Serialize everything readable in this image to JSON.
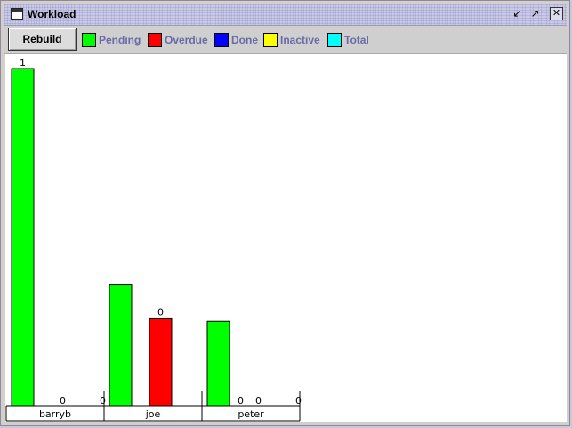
{
  "window": {
    "title": "Workload",
    "icon": "app-window-icon"
  },
  "titlebar_buttons": {
    "minimize": "↙",
    "maximize": "↗",
    "close": "✕"
  },
  "toolbar": {
    "rebuild_label": "Rebuild"
  },
  "legend": [
    {
      "label": "Pending",
      "color": "#00ff00"
    },
    {
      "label": "Overdue",
      "color": "#ff0000"
    },
    {
      "label": "Done",
      "color": "#0000ff"
    },
    {
      "label": "Inactive",
      "color": "#ffff00"
    },
    {
      "label": "Total",
      "color": "#00ffff"
    }
  ],
  "chart_data": {
    "type": "bar",
    "categories": [
      "barryb",
      "joe",
      "peter"
    ],
    "ylim": [
      0,
      1
    ],
    "series": [
      {
        "name": "Pending",
        "color": "#00ff00",
        "values": [
          1,
          0.36,
          0.25
        ],
        "labels": [
          "1",
          "",
          ""
        ]
      },
      {
        "name": "Overdue",
        "color": "#ff0000",
        "values": [
          0,
          0.26,
          0
        ],
        "labels": [
          "0",
          "0",
          "0"
        ]
      },
      {
        "name": "Done",
        "color": "#0000ff",
        "values": [
          0,
          0,
          0
        ],
        "labels": [
          "0",
          "",
          "0"
        ]
      },
      {
        "name": "Inactive",
        "color": "#ffff00",
        "values": [
          0,
          0,
          0
        ],
        "labels": [
          "",
          "0",
          ""
        ]
      },
      {
        "name": "Total",
        "color": "#00ffff",
        "values": [
          0,
          0,
          0
        ],
        "labels": [
          "",
          "",
          ""
        ]
      }
    ]
  }
}
